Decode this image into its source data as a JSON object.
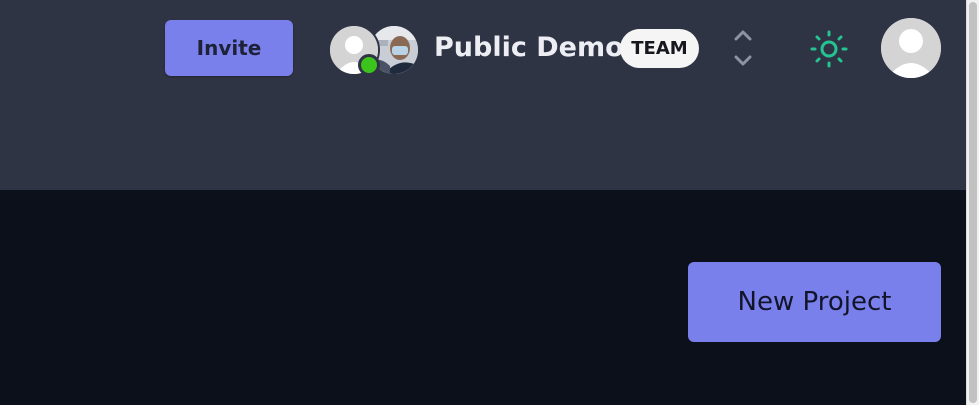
{
  "header": {
    "invite_label": "Invite",
    "team_name": "Public Demo",
    "team_badge": "TEAM",
    "members": [
      {
        "icon": "user-placeholder-icon",
        "status": "online"
      },
      {
        "icon": "member-photo"
      }
    ],
    "icons": {
      "switcher": "chevron-up-down-icon",
      "theme": "sun-icon",
      "user": "user-avatar-icon"
    }
  },
  "main": {
    "new_project_label": "New Project"
  },
  "colors": {
    "header_bg": "#2f3444",
    "page_bg": "#0c101b",
    "accent": "#7a80eb",
    "online": "#3bc41b",
    "sun": "#23c48f"
  }
}
